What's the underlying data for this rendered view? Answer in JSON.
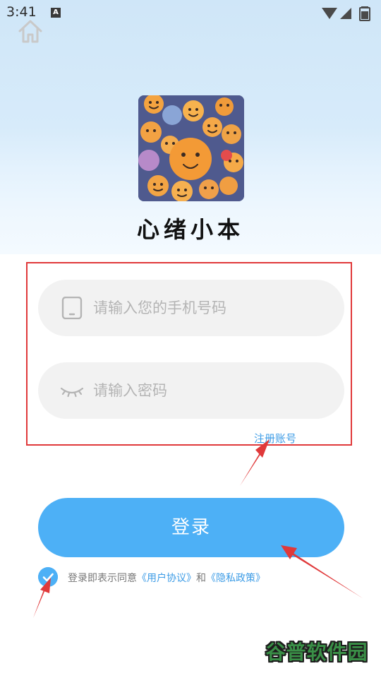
{
  "status_bar": {
    "time": "3:41",
    "notification_badge": "A"
  },
  "app": {
    "title": "心绪小本",
    "logo_icon": "emoji-collage-logo"
  },
  "form": {
    "phone_placeholder": "请输入您的手机号码",
    "phone_icon": "phone-icon",
    "password_placeholder": "请输入密码",
    "password_icon": "eye-closed-icon",
    "register_link": "注册账号"
  },
  "login": {
    "button_label": "登录"
  },
  "agreement": {
    "checked": true,
    "prefix": "登录即表示同意",
    "user_agreement": "《用户协议》",
    "and": "和",
    "privacy_policy": "《隐私政策》"
  },
  "watermark": {
    "text": "谷普软件园"
  },
  "colors": {
    "accent": "#4db0f6",
    "link": "#3d9ce6",
    "annotation": "#e0393a",
    "field_bg": "#f2f2f2"
  }
}
